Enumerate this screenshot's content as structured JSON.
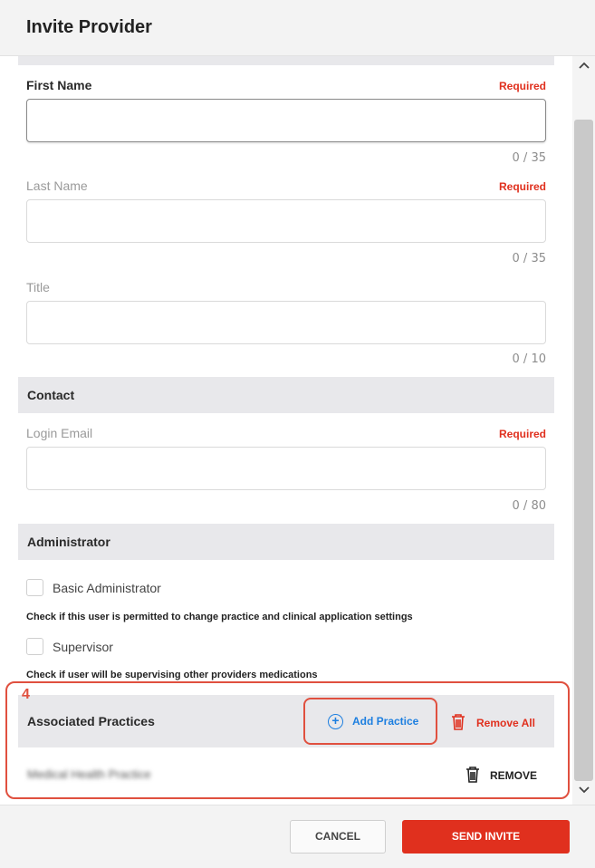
{
  "dialog": {
    "title": "Invite Provider"
  },
  "fields": {
    "first_name": {
      "label": "First Name",
      "required": "Required",
      "value": "",
      "counter": "0 / 35"
    },
    "last_name": {
      "label": "Last Name",
      "required": "Required",
      "value": "",
      "counter": "0 / 35"
    },
    "title": {
      "label": "Title",
      "value": "",
      "counter": "0 / 10"
    },
    "login_email": {
      "label": "Login Email",
      "required": "Required",
      "value": "",
      "counter": "0 / 80"
    }
  },
  "sections": {
    "contact": "Contact",
    "administrator": "Administrator",
    "associated_practices": "Associated Practices"
  },
  "administrator": {
    "basic_admin_label": "Basic Administrator",
    "basic_admin_checked": false,
    "basic_admin_help": "Check if this user is permitted to change practice and clinical application settings",
    "supervisor_label": "Supervisor",
    "supervisor_checked": false,
    "supervisor_help": "Check if user will be supervising other providers medications"
  },
  "associated_practices": {
    "add_label": "Add Practice",
    "remove_all_label": "Remove All",
    "rows": [
      {
        "name": "Medical Health Practice",
        "remove_label": "REMOVE"
      }
    ]
  },
  "annotation": {
    "number": "4"
  },
  "footer": {
    "cancel_label": "CANCEL",
    "send_label": "SEND INVITE"
  },
  "colors": {
    "accent_red": "#e0301e",
    "link_blue": "#1d7fe0",
    "annotation": "#e0503f"
  },
  "icons": [
    "plus-circle-icon",
    "trash-icon",
    "chevron-up-icon",
    "chevron-down-icon"
  ]
}
